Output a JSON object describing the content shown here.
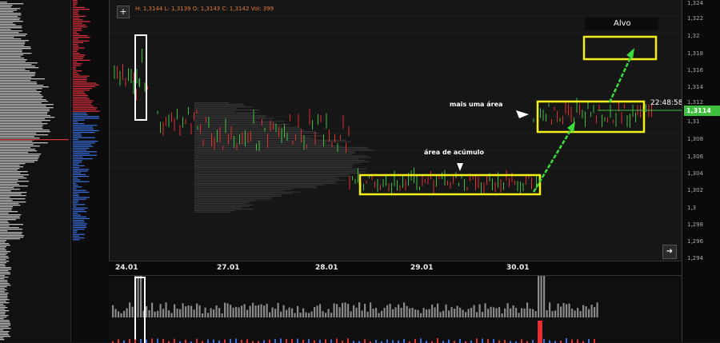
{
  "main": {
    "ohlc_text": "H: 1,3144 L: 1,3139 O: 1,3143 C: 1,3142    Vol: 399",
    "plus_label": "+",
    "arrow_label": "➜"
  },
  "annotations": {
    "mais_uma_area": "mais uma área",
    "area_acumulo": "área de acúmulo",
    "alvo": "Alvo"
  },
  "clock": "22:48:58",
  "current_price": "1,3114",
  "price_axis": {
    "ticks": [
      "1,324",
      "1,322",
      "1,32",
      "1,318",
      "1,316",
      "1,314",
      "1,312",
      "1,31",
      "1,308",
      "1,306",
      "1,304",
      "1,302",
      "1,3",
      "1,298",
      "1,296",
      "1,294"
    ]
  },
  "date_axis": {
    "labels": [
      "24.01",
      "27.01",
      "28.01",
      "29.01",
      "30.01"
    ]
  },
  "colors": {
    "highlight": "#f5ef1a",
    "arrow": "#3ddc3d",
    "up": "#3fbf3f",
    "down": "#e03030"
  }
}
